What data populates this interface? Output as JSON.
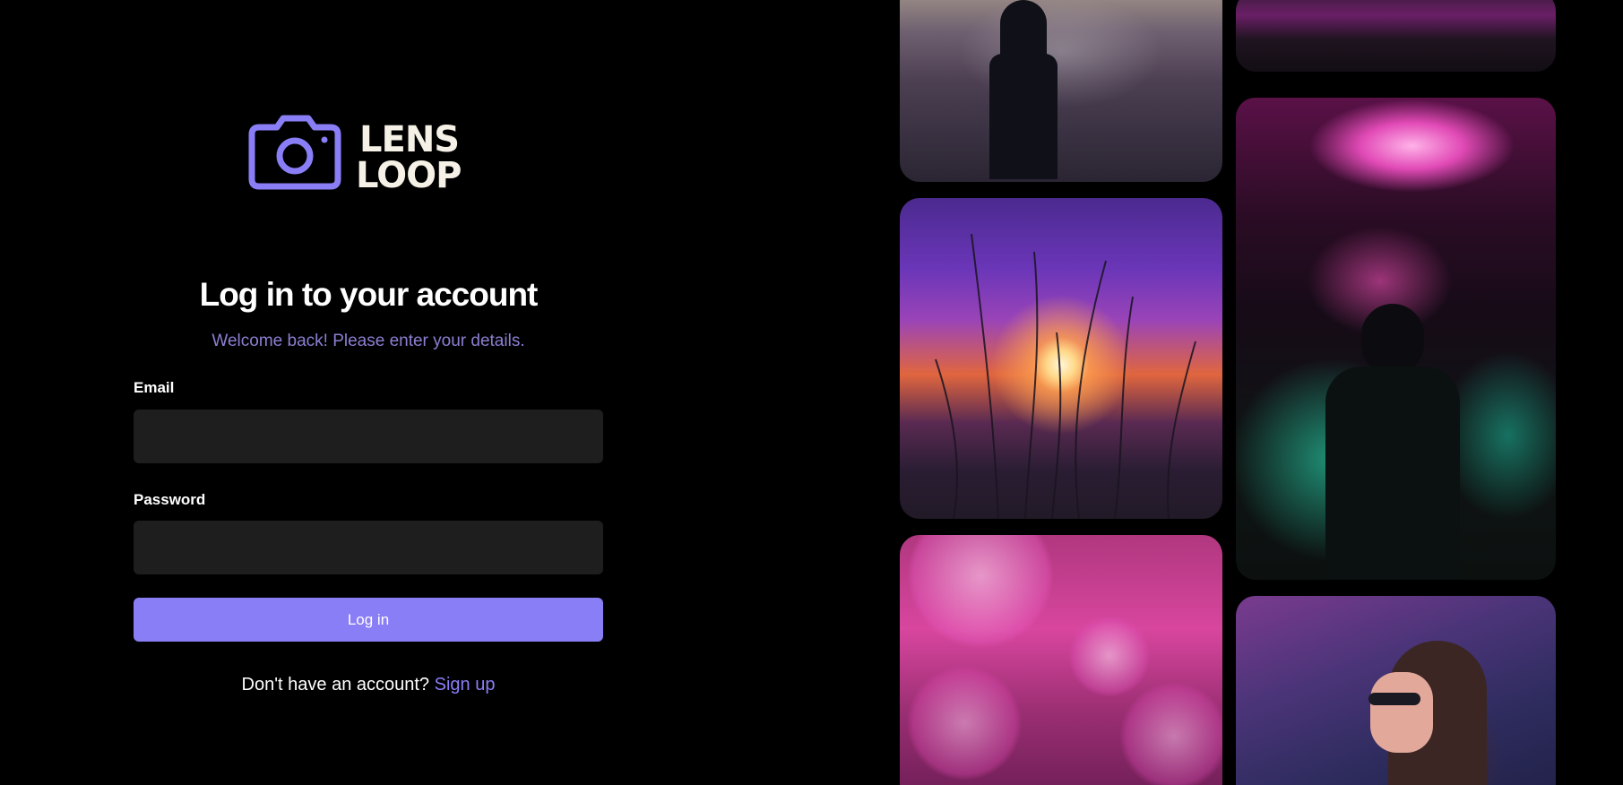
{
  "brand": {
    "name_line1": "LENS",
    "name_line2": "LOOP",
    "logo_icon": "camera-icon",
    "accent_color": "#8a7ef6"
  },
  "login": {
    "title": "Log in to your account",
    "subtitle": "Welcome back! Please enter your details.",
    "email_label": "Email",
    "email_value": "",
    "password_label": "Password",
    "password_value": "",
    "submit_label": "Log in",
    "signup_prompt": "Don't have an account?",
    "signup_link": "Sign up"
  },
  "gallery": {
    "images": [
      "foggy-silhouette-photo",
      "neon-ceiling-photo",
      "sunset-plants-photo",
      "smoke-neon-person-photo",
      "pink-bubbles-photo",
      "woman-sunglasses-photo"
    ]
  }
}
